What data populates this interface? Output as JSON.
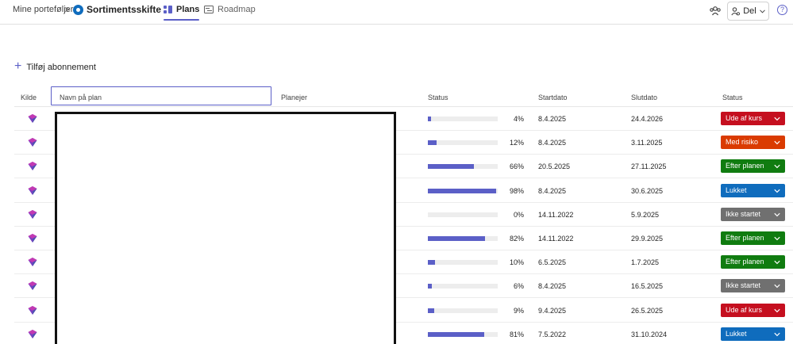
{
  "breadcrumb": {
    "root": "Mine porteføljer",
    "separator": ">",
    "current": "Sortimentsskifte"
  },
  "tabs": [
    {
      "label": "Plans",
      "active": true
    },
    {
      "label": "Roadmap",
      "active": false
    }
  ],
  "header_actions": {
    "share_label": "Del",
    "help_label": "?"
  },
  "add_subscription_label": "Tilføj abonnement",
  "columns": {
    "source": "Kilde",
    "name_placeholder": "Navn på plan",
    "planner": "Planejer",
    "status_progress": "Status",
    "start": "Startdato",
    "end": "Slutdato",
    "status": "Status"
  },
  "colors": {
    "accent": "#5b5fc7",
    "off_track": "#c50f1f",
    "at_risk": "#da3b01",
    "on_track": "#107c10",
    "closed": "#0f6cbd",
    "not_started": "#707070"
  },
  "rows": [
    {
      "progress": "4%",
      "start": "8.4.2025",
      "end": "24.4.2026",
      "status": "Ude af kurs",
      "status_color": "#c50f1f"
    },
    {
      "progress": "12%",
      "start": "8.4.2025",
      "end": "3.11.2025",
      "status": "Med risiko",
      "status_color": "#da3b01"
    },
    {
      "progress": "66%",
      "start": "20.5.2025",
      "end": "27.11.2025",
      "status": "Efter planen",
      "status_color": "#107c10"
    },
    {
      "progress": "98%",
      "start": "8.4.2025",
      "end": "30.6.2025",
      "status": "Lukket",
      "status_color": "#0f6cbd"
    },
    {
      "progress": "0%",
      "start": "14.11.2022",
      "end": "5.9.2025",
      "status": "Ikke startet",
      "status_color": "#707070"
    },
    {
      "progress": "82%",
      "start": "14.11.2022",
      "end": "29.9.2025",
      "status": "Efter planen",
      "status_color": "#107c10"
    },
    {
      "progress": "10%",
      "start": "6.5.2025",
      "end": "1.7.2025",
      "status": "Efter planen",
      "status_color": "#107c10"
    },
    {
      "progress": "6%",
      "start": "8.4.2025",
      "end": "16.5.2025",
      "status": "Ikke startet",
      "status_color": "#707070"
    },
    {
      "progress": "9%",
      "start": "9.4.2025",
      "end": "26.5.2025",
      "status": "Ude af kurs",
      "status_color": "#c50f1f"
    },
    {
      "progress": "81%",
      "start": "7.5.2022",
      "end": "31.10.2024",
      "status": "Lukket",
      "status_color": "#0f6cbd"
    }
  ]
}
